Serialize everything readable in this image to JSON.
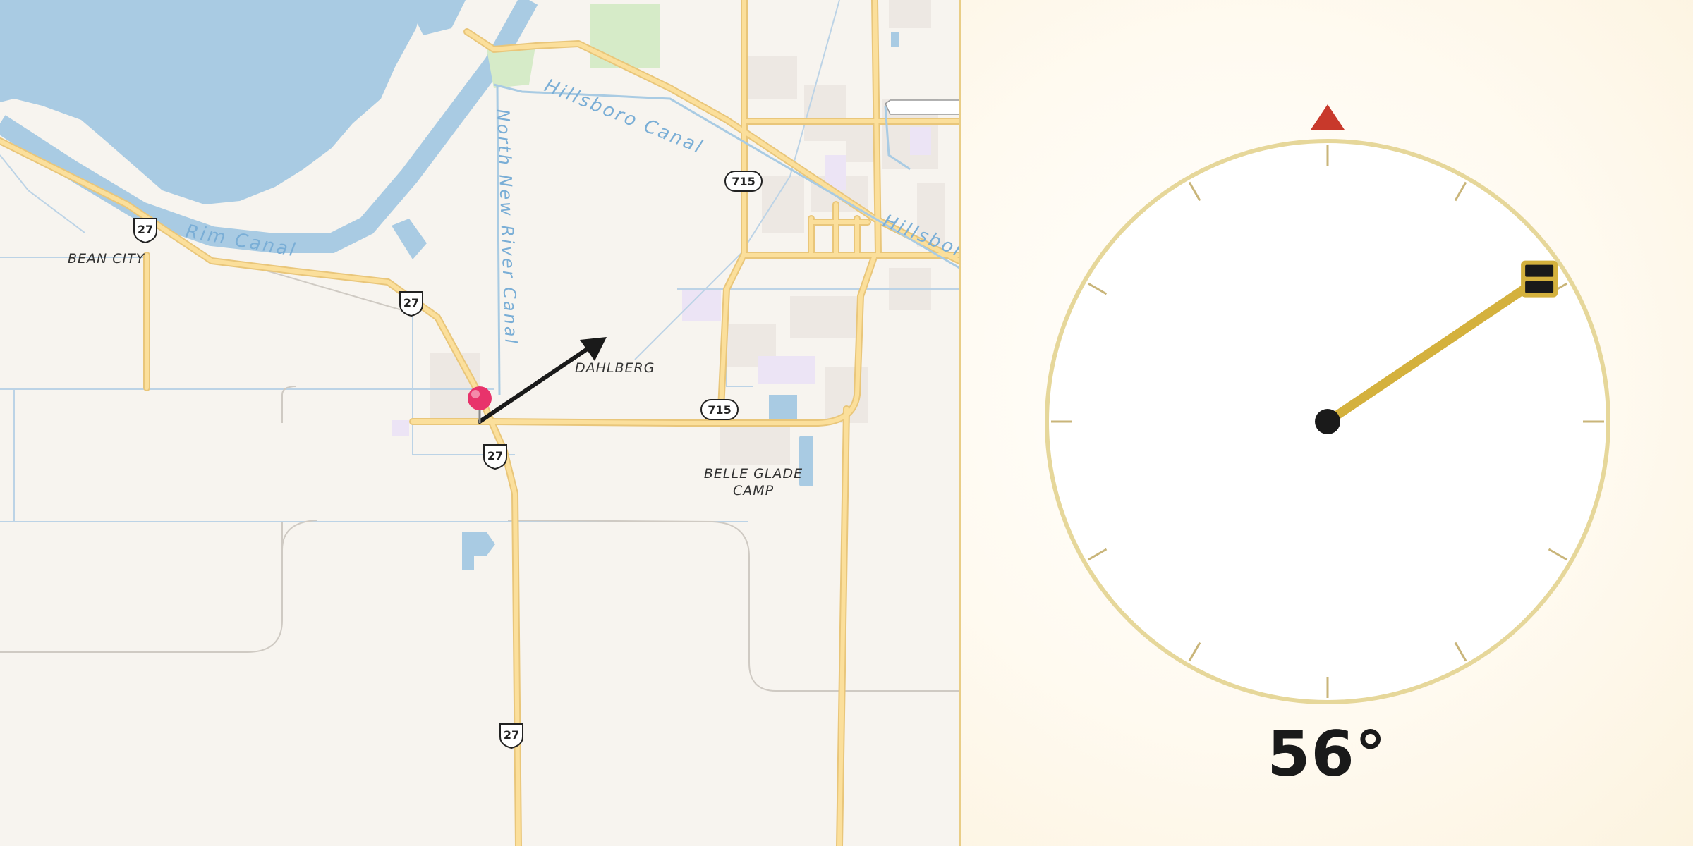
{
  "map": {
    "place_labels": {
      "bean_city": "BEAN CITY",
      "dahlberg": "DAHLBERG",
      "belle_glade_camp_1": "BELLE GLADE",
      "belle_glade_camp_2": "CAMP"
    },
    "water_labels": {
      "hillsboro_canal": "Hillsboro Canal",
      "hillsboro_canal_2": "Hillsbor",
      "rim_canal": "Rim Canal",
      "north_new_river_canal": "North New River Canal"
    },
    "shields": {
      "us27_a": "27",
      "us27_b": "27",
      "us27_c": "27",
      "us27_d": "27",
      "sr715_a": "715",
      "sr715_b": "715"
    },
    "marker": {
      "type": "pin",
      "color": "#e8336b"
    },
    "direction_arrow": {
      "color": "#1a1a1a"
    }
  },
  "dial": {
    "bearing_deg": 56,
    "readout": "56°",
    "north_marker_color": "#c8392b",
    "needle_color": "#d4b13d",
    "rim_color": "#e6d79a"
  }
}
